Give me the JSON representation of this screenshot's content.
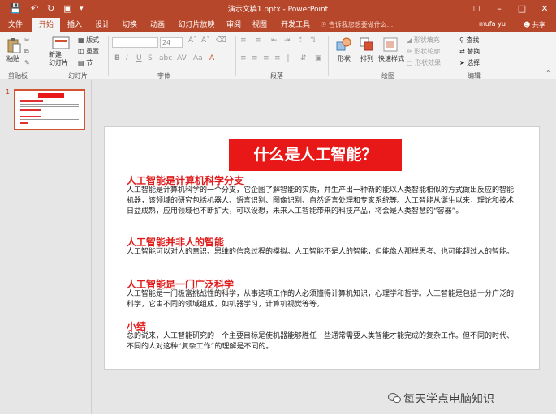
{
  "window": {
    "title": "演示文稿1.pptx - PowerPoint",
    "quick_access": [
      "save-icon",
      "undo-icon",
      "redo-icon",
      "start-from-beginning-icon",
      "customize-icon"
    ]
  },
  "tabs": [
    {
      "label": "文件",
      "active": false
    },
    {
      "label": "开始",
      "active": true
    },
    {
      "label": "插入",
      "active": false
    },
    {
      "label": "设计",
      "active": false
    },
    {
      "label": "切换",
      "active": false
    },
    {
      "label": "动画",
      "active": false
    },
    {
      "label": "幻灯片放映",
      "active": false
    },
    {
      "label": "审阅",
      "active": false
    },
    {
      "label": "视图",
      "active": false
    },
    {
      "label": "开发工具",
      "active": false
    }
  ],
  "tell_me": "告诉我您想要做什么...",
  "user": "mufa yu",
  "share": "共享",
  "ribbon": {
    "clipboard": {
      "paste": "粘贴",
      "label": "剪贴板"
    },
    "slides": {
      "new_slide": "新建\n幻灯片",
      "layout": "版式",
      "reset": "重置",
      "section": "节",
      "label": "幻灯片"
    },
    "font": {
      "font_size": "24",
      "label": "字体"
    },
    "paragraph": {
      "label": "段落"
    },
    "drawing": {
      "shapes": "形状",
      "arrange": "排列",
      "quick_styles": "快速样式",
      "fill": "形状填充",
      "outline": "形状轮廓",
      "effects": "形状效果",
      "label": "绘图"
    },
    "editing": {
      "find": "查找",
      "replace": "替换",
      "select": "选择",
      "label": "编辑"
    }
  },
  "thumbnail_number": "1",
  "slide": {
    "title": "什么是人工智能？",
    "sections": [
      {
        "heading": "人工智能是计算机科学分支",
        "body": "人工智能是计算机科学的一个分支，它企图了解智能的实质，并生产出一种新的能以人类智能相似的方式做出反应的智能机器，该领域的研究包括机器人、语言识别、图像识别、自然语言处理和专家系统等。人工智能从诞生以来，理论和技术日益成熟，应用领域也不断扩大，可以设想，未来人工智能带来的科技产品，将会是人类智慧的“容器”。"
      },
      {
        "heading": "人工智能并非人的智能",
        "body": "人工智能可以对人的意识、思维的信息过程的模拟。人工智能不是人的智能，但能像人那样思考、也可能超过人的智能。"
      },
      {
        "heading": "人工智能是一门广泛科学",
        "body": "人工智能是一门极富挑战性的科学，从事这项工作的人必须懂得计算机知识，心理学和哲学。人工智能是包括十分广泛的科学，它由不同的领域组成，如机器学习，计算机视觉等等。"
      },
      {
        "heading": "小结",
        "body": "总的说来，人工智能研究的一个主要目标是使机器能够胜任一些通常需要人类智能才能完成的复杂工作。但不同的时代、不同的人对这种“复杂工作”的理解是不同的。"
      }
    ]
  },
  "watermark": "每天学点电脑知识",
  "colors": {
    "accent": "#b7472a",
    "title_fill": "#e81818",
    "heading": "#e01b1b"
  }
}
